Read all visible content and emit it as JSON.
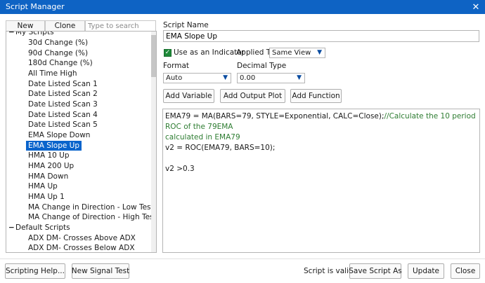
{
  "window": {
    "title": "Script Manager",
    "close_glyph": "✕"
  },
  "left": {
    "new_label": "New",
    "clone_label": "Clone",
    "search_placeholder": "Type to search",
    "groups": [
      {
        "label": "My Scripts",
        "toggle": "−",
        "items": [
          "30d Change (%)",
          "90d Change (%)",
          "180d Change (%)",
          "All Time High",
          "Date Listed Scan 1",
          "Date Listed Scan 2",
          "Date Listed Scan 3",
          "Date Listed Scan 4",
          "Date Listed Scan 5",
          "EMA Slope Down",
          "EMA Slope Up",
          "HMA 10 Up",
          "HMA 200 Up",
          "HMA Down",
          "HMA Up",
          "HMA Up 1",
          "MA Change in Direction - Low Test",
          "MA Change of Direction - High Test"
        ]
      },
      {
        "label": "Default Scripts",
        "toggle": "−",
        "items": [
          "ADX DM- Crosses Above ADX",
          "ADX DM- Crosses Below ADX"
        ]
      }
    ],
    "selected_item": "EMA Slope Up"
  },
  "right": {
    "script_name_label": "Script Name",
    "script_name_value": "EMA Slope Up",
    "indicator_check_label": "Use as an Indicator",
    "indicator_checked": true,
    "applied_to_label": "Applied To",
    "applied_to_value": "Same View",
    "format_label": "Format",
    "format_value": "Auto",
    "decimal_label": "Decimal Type",
    "decimal_value": "0.00",
    "add_variable_label": "Add Variable",
    "add_output_plot_label": "Add Output Plot",
    "add_function_label": "Add Function",
    "code_lines": [
      {
        "code": "EMA79 = MA(BARS=79, STYLE=Exponential, CALC=Close);",
        "comment": "//Calculate the 10 period ROC of the 79EMA"
      },
      {
        "code": "",
        "comment": "calculated in EMA79"
      },
      {
        "code": "v2 = ROC(EMA79, BARS=10);",
        "comment": ""
      },
      {
        "code": "",
        "comment": ""
      },
      {
        "code": "v2 >0.3",
        "comment": ""
      }
    ]
  },
  "footer": {
    "scripting_help_label": "Scripting Help...",
    "new_signal_test_label": "New Signal Test",
    "status_text": "Script is valid",
    "save_as_label": "Save Script As",
    "update_label": "Update",
    "close_label": "Close"
  },
  "colors": {
    "titlebar": "#0e63c4",
    "selection": "#0a64cc",
    "comment": "#2e7d32",
    "checkbox": "#1f8a3a"
  }
}
